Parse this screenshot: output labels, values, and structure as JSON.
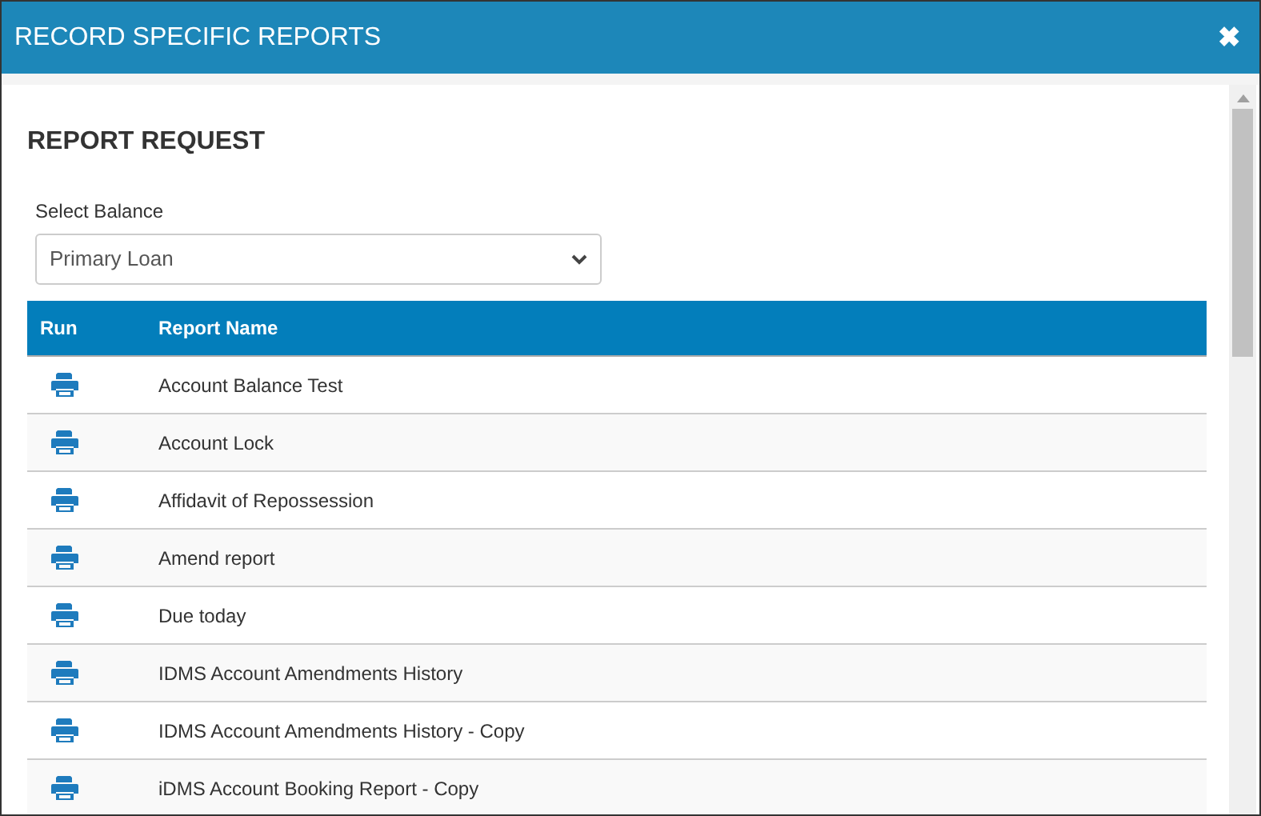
{
  "window": {
    "title": "RECORD SPECIFIC REPORTS",
    "close": "✖"
  },
  "section_title": "REPORT REQUEST",
  "balance_select": {
    "label": "Select Balance",
    "value": "Primary Loan"
  },
  "table": {
    "columns": [
      "Run",
      "Report Name"
    ],
    "rows": [
      {
        "name": "Account Balance Test"
      },
      {
        "name": "Account Lock"
      },
      {
        "name": "Affidavit of Repossession"
      },
      {
        "name": "Amend report"
      },
      {
        "name": "Due today"
      },
      {
        "name": "IDMS Account Amendments History"
      },
      {
        "name": "IDMS Account Amendments History - Copy"
      },
      {
        "name": "iDMS Account Booking Report - Copy"
      }
    ]
  }
}
